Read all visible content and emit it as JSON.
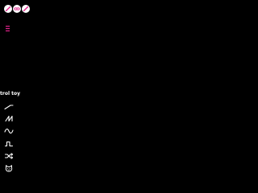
{
  "colors": {
    "background": "#000000",
    "button_fill": "#ffffff",
    "button_icon": "#e0218a",
    "menu_icon": "#e0218a",
    "tool_icon": "#ffffff",
    "label_text": "#ffffff"
  },
  "top_buttons": [
    {
      "icon": "slash-circle-icon"
    },
    {
      "icon": "link-icon"
    },
    {
      "icon": "slash-circle-icon"
    }
  ],
  "menu": {
    "icon": "hamburger-menu-icon"
  },
  "section": {
    "label": "trol toy"
  },
  "tools": [
    {
      "icon": "linear-ramp-icon"
    },
    {
      "icon": "sawtooth-wave-icon"
    },
    {
      "icon": "sine-wave-icon"
    },
    {
      "icon": "square-wave-icon"
    },
    {
      "icon": "shuffle-icon"
    },
    {
      "icon": "cat-face-icon"
    }
  ]
}
